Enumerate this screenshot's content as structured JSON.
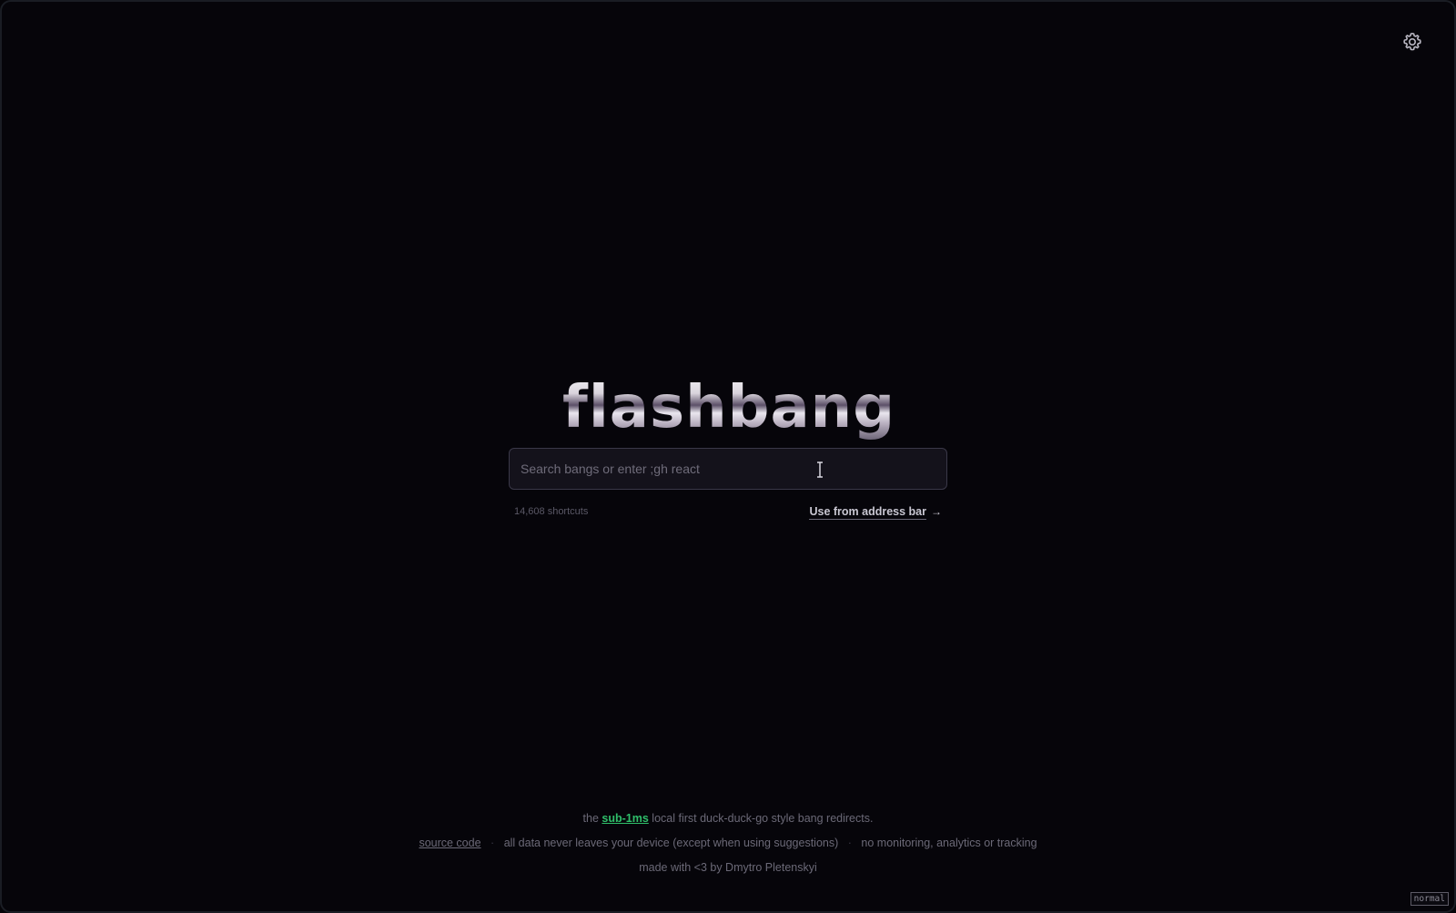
{
  "header": {
    "settings_icon": "gear-icon"
  },
  "brand": {
    "logo_text": "flashbang"
  },
  "search": {
    "placeholder": "Search bangs or enter ;gh react",
    "value": ""
  },
  "meta": {
    "shortcut_count": "14,608 shortcuts",
    "address_bar_link": "Use from address bar",
    "address_bar_arrow": "→"
  },
  "footer": {
    "tagline_prefix": "the",
    "tagline_highlight": "sub-1ms",
    "tagline_suffix": "local first duck-duck-go style bang redirects.",
    "source_code": "source code",
    "privacy_note": "all data never leaves your device (except when using suggestions)",
    "separator": "·",
    "tracking_note": "no monitoring, analytics or tracking",
    "credits": "made with <3 by Dmytro Pletenskyi"
  },
  "status": {
    "mode": "normal"
  },
  "colors": {
    "background": "#06050a",
    "accent": "#2fbf6a",
    "input_bg": "#14121b"
  }
}
